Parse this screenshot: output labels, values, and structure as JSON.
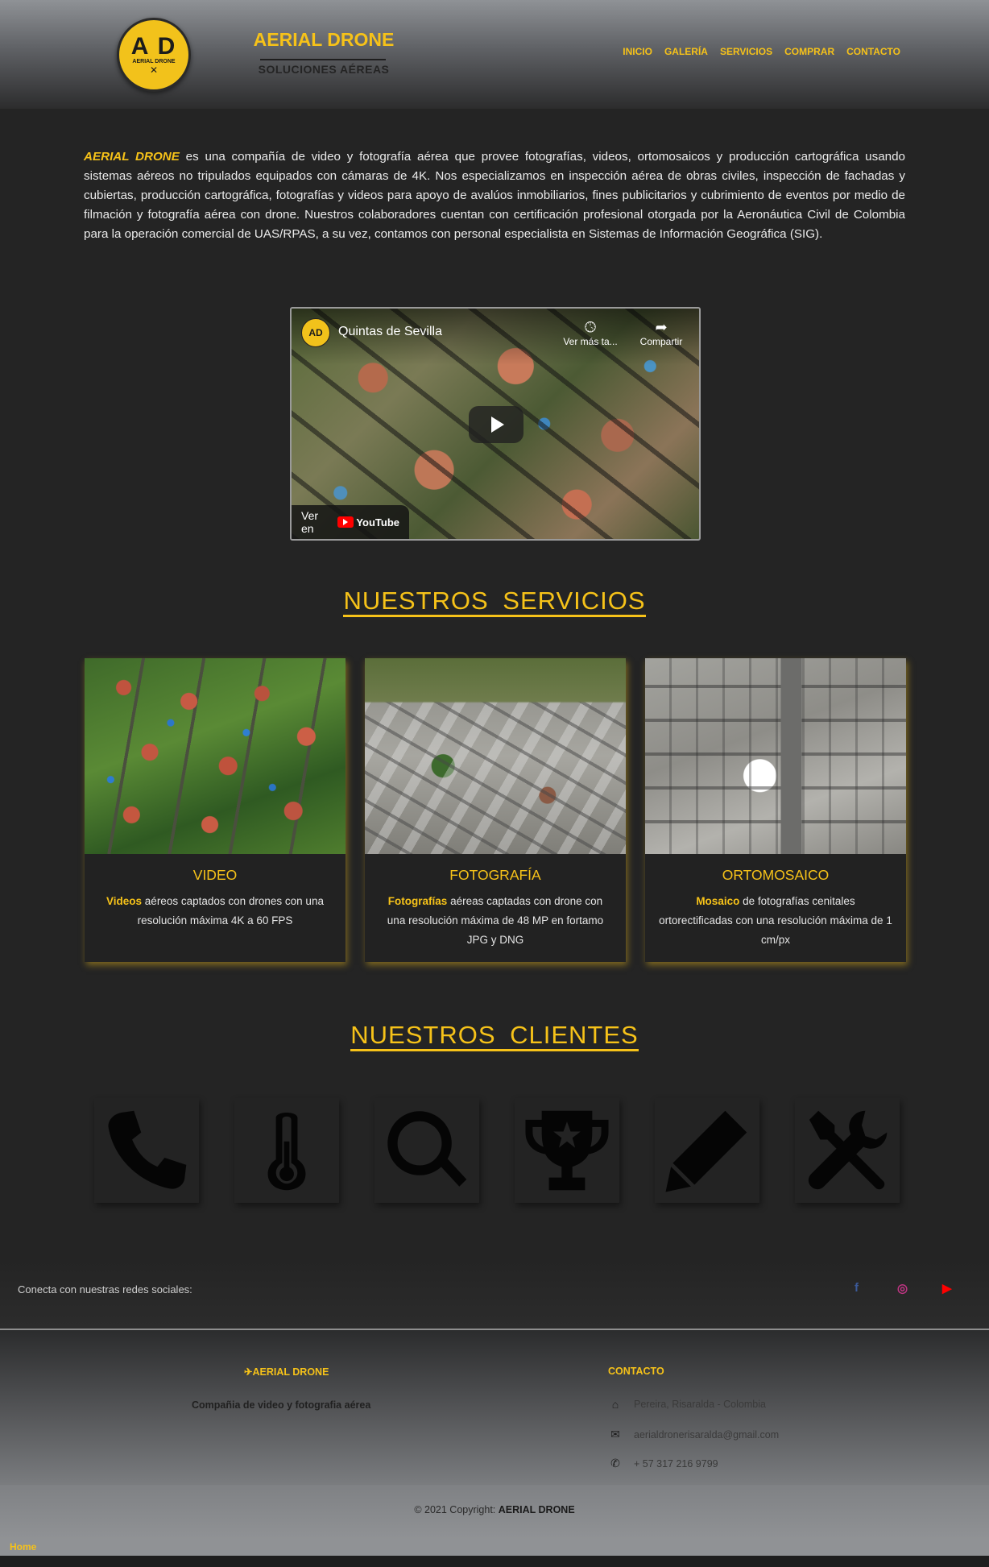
{
  "header": {
    "logo_letters": "A D",
    "logo_small": "AERIAL DRONE",
    "brand_title": "AERIAL DRONE",
    "brand_subtitle": "SOLUCIONES AÉREAS",
    "nav": [
      "INICIO",
      "GALERÍA",
      "SERVICIOS",
      "COMPRAR",
      "CONTACTO"
    ],
    "brand_color": "#f6c219"
  },
  "intro": {
    "brand": "AERIAL DRONE",
    "text": " es una compañía de video y fotografía aérea que provee fotografías, videos, ortomosaicos y producción cartográfica usando sistemas aéreos no tripulados equipados con cámaras de 4K. Nos especializamos en inspección aérea de obras civiles, inspección de fachadas y cubiertas, producción cartográfica, fotografías y videos para apoyo de avalúos inmobiliarios, fines publicitarios y cubrimiento de eventos por medio de filmación y fotografía aérea con drone. Nuestros colaboradores cuentan con certificación profesional otorgada por la Aeronáutica Civil de Colombia para la operación comercial de UAS/RPAS, a su vez, contamos con personal especialista en Sistemas de Información Geográfica (SIG)."
  },
  "video": {
    "avatar": "AD",
    "title": "Quintas de Sevilla",
    "watch_later": "Ver más ta...",
    "share": "Compartir",
    "watch_on": "Ver en",
    "youtube": "YouTube"
  },
  "services": {
    "title": "NUESTROS SERVICIOS",
    "cards": [
      {
        "title": "VIDEO",
        "bold": "Videos",
        "desc": " aéreos captados con drones con una resolución máxima 4K a 60 FPS"
      },
      {
        "title": "FOTOGRAFÍA",
        "bold": "Fotografías",
        "desc": " aéreas captadas con drone con una resolución máxima de 48 MP en fortamo JPG y DNG"
      },
      {
        "title": "ORTOMOSAICO",
        "bold": "Mosaico",
        "desc": " de fotografías cenitales ortorectificadas con una resolución máxima de 1 cm/px"
      }
    ]
  },
  "clients": {
    "title": "NUESTROS CLIENTES",
    "icons": [
      "phone-icon",
      "thermometer-icon",
      "search-icon",
      "trophy-icon",
      "pencil-icon",
      "tools-icon"
    ]
  },
  "social": {
    "text": "Conecta con nuestras redes sociales:",
    "facebook": "f",
    "instagram": "◎",
    "youtube": "▶",
    "colors": {
      "facebook": "#3b5998",
      "instagram": "#c13584",
      "youtube": "#ff0000"
    }
  },
  "footer": {
    "brand": "AERIAL DRONE",
    "tagline": "Compañia de video y fotografia aérea",
    "contact_title": "CONTACTO",
    "address": "Pereira, Risaralda - Colombia",
    "email": "aerialdronerisaralda@gmail.com",
    "phone": "+ 57 317 216 9799",
    "copyright_prefix": "© 2021 Copyright: ",
    "copyright_brand": "AERIAL DRONE",
    "home": "Home"
  }
}
